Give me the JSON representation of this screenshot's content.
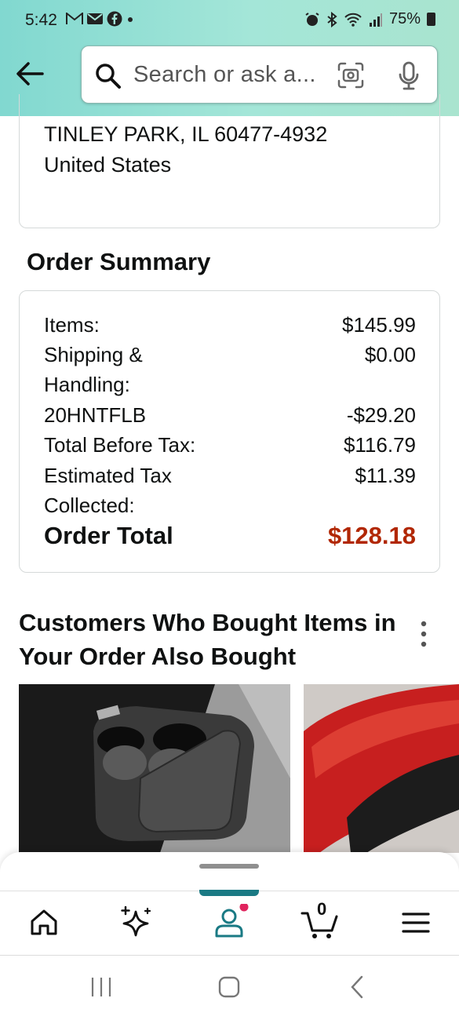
{
  "status_bar": {
    "time": "5:42",
    "notif_icons": [
      "gmail-icon",
      "mail-icon",
      "facebook-icon",
      "dot-icon"
    ],
    "battery": "75%"
  },
  "header": {
    "search_placeholder": "Search or ask a..."
  },
  "address": {
    "line1": "TINLEY PARK, IL 60477-4932",
    "line2": "United States"
  },
  "order_summary": {
    "title": "Order Summary",
    "rows": [
      {
        "label": "Items:",
        "value": "$145.99"
      },
      {
        "label": "Shipping & Handling:",
        "value": "$0.00"
      },
      {
        "label": "20HNTFLB",
        "value": "-$29.20"
      },
      {
        "label": "Total Before Tax:",
        "value": "$116.79"
      },
      {
        "label": "Estimated Tax Collected:",
        "value": "$11.39"
      }
    ],
    "total_label": "Order Total",
    "total_value": "$128.18"
  },
  "recommendations": {
    "title": "Customers Who Bought Items in Your Order Also Bought"
  },
  "bottom_nav": {
    "cart_count": "0",
    "items": [
      "home-icon",
      "rufus-sparkle-icon",
      "account-icon",
      "cart-icon",
      "menu-icon"
    ]
  },
  "colors": {
    "header_teal": "#81d8d0",
    "price_red": "#b12704",
    "nav_accent": "#1a7a84",
    "badge_pink": "#e0245e"
  }
}
